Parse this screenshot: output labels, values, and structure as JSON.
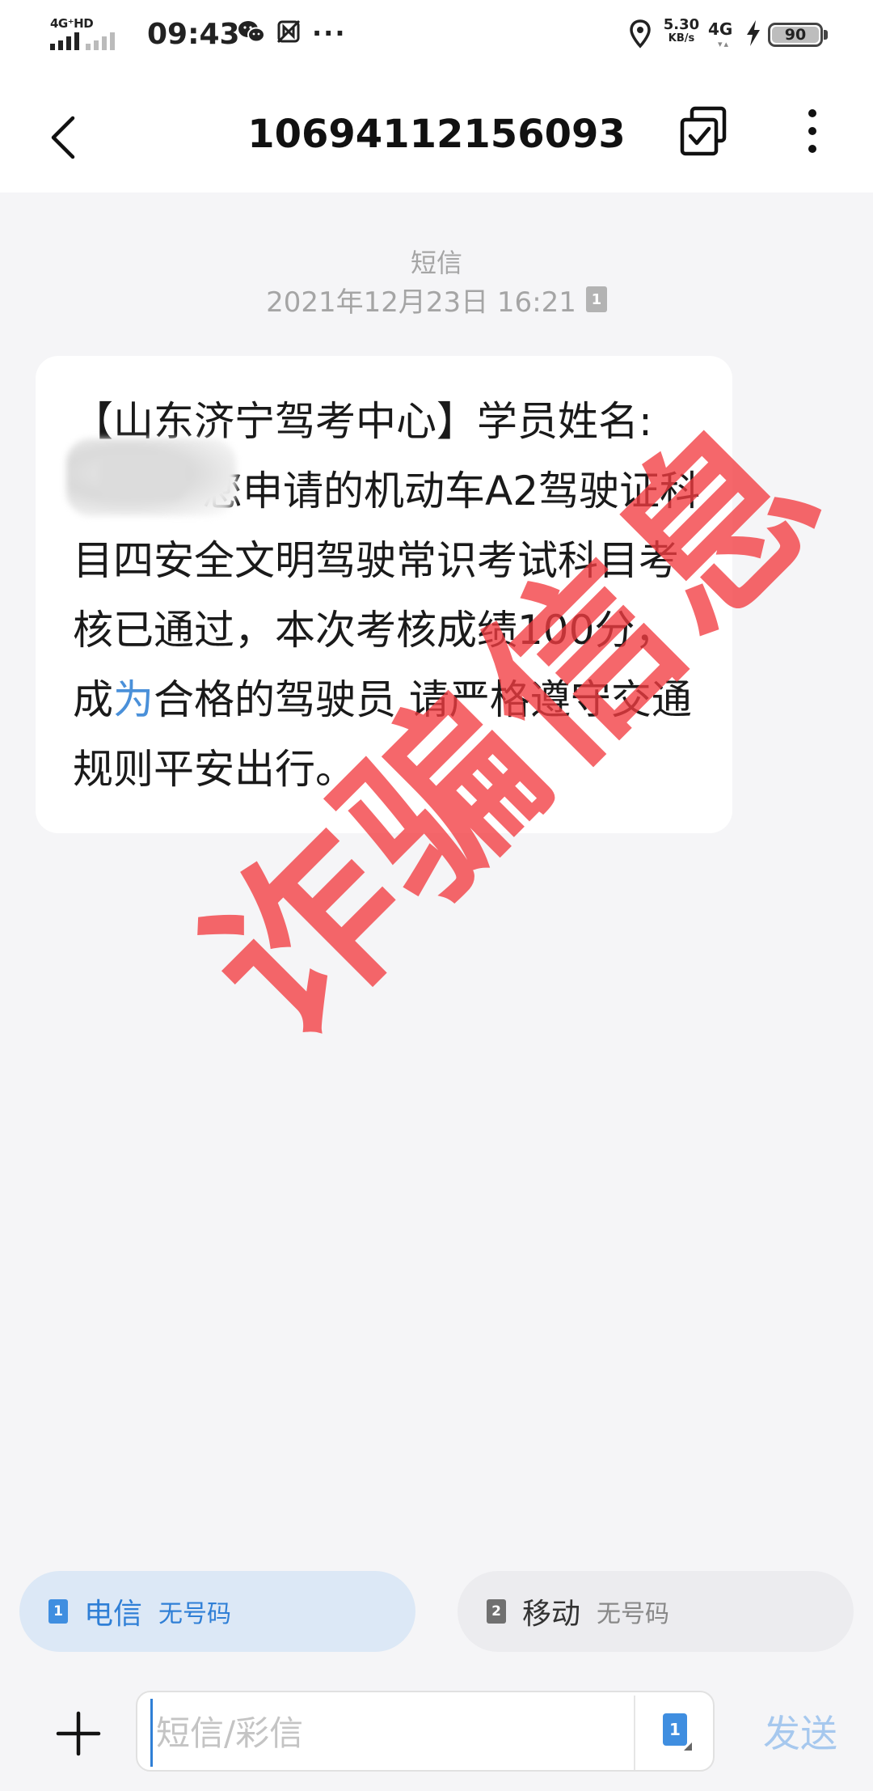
{
  "status_bar": {
    "network_type": "4G⁺HD",
    "time": "09:43",
    "speed_value": "5.30",
    "speed_unit": "KB/s",
    "mobile_data": "4G",
    "battery": "90",
    "icons": [
      "signal-icon",
      "wechat-icon",
      "nfc-icon",
      "more-dots-icon",
      "location-icon",
      "charging-icon",
      "battery-icon"
    ]
  },
  "header": {
    "title": "10694112156093",
    "icons": [
      "back-arrow-icon",
      "multi-select-icon",
      "more-vertical-icon"
    ]
  },
  "conversation": {
    "message_type": "短信",
    "timestamp": "2021年12月23日 16:21",
    "sim_indicator": "1",
    "message": {
      "part1": "【山东济宁驾考中心】学员姓名:",
      "part2": "您申请的机动车A2驾驶证科目四安全文明驾驶常识考试科目考核已通过，本次考核成绩100分，成",
      "highlight": "为",
      "part3": "合格的驾驶员 请严格遵守交通规则平安出行。"
    },
    "watermark": "诈骗信息"
  },
  "sim_selector": {
    "sim1": {
      "badge": "1",
      "carrier": "电信",
      "status": "无号码"
    },
    "sim2": {
      "badge": "2",
      "carrier": "移动",
      "status": "无号码"
    }
  },
  "compose": {
    "placeholder": "短信/彩信",
    "sim_badge": "1",
    "send_label": "发送"
  },
  "colors": {
    "accent": "#2f7fd6",
    "watermark": "#f23c41",
    "background": "#f5f5f7"
  }
}
